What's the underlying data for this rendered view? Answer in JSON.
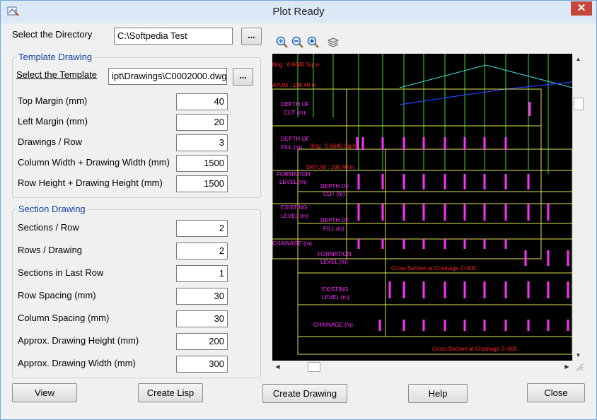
{
  "window": {
    "title": "Plot Ready",
    "close_glyph": "✕"
  },
  "directory": {
    "label": "Select the Directory",
    "value": "C:\\Softpedia Test",
    "browse_label": "..."
  },
  "template_group": {
    "title": "Template Drawing",
    "select_label": "Select the Template",
    "template_value": "ipt\\Drawings\\C0002000.dwg",
    "browse_label": "...",
    "fields": [
      {
        "label": "Top Margin (mm)",
        "value": "40"
      },
      {
        "label": "Left Margin (mm)",
        "value": "20"
      },
      {
        "label": "Drawings / Row",
        "value": "3"
      },
      {
        "label": "Column Width + Drawing Width (mm)",
        "value": "1500"
      },
      {
        "label": "Row Height + Drawing Height (mm)",
        "value": "1500"
      }
    ]
  },
  "section_group": {
    "title": "Section Drawing",
    "fields": [
      {
        "label": "Sections / Row",
        "value": "2"
      },
      {
        "label": "Rows / Drawing",
        "value": "2"
      },
      {
        "label": "Sections in Last Row",
        "value": "1"
      },
      {
        "label": "Row Spacing (mm)",
        "value": "30"
      },
      {
        "label": "Column Spacing (mm)",
        "value": "30"
      },
      {
        "label": "Approx. Drawing Height (mm)",
        "value": "200"
      },
      {
        "label": "Approx. Drawing Width (mm)",
        "value": "300"
      }
    ]
  },
  "toolbar": {
    "icons": [
      "zoom-extents-icon",
      "zoom-out-icon",
      "zoom-in-icon",
      "layers-icon"
    ]
  },
  "cad_preview": {
    "labels": {
      "area_top": "lling : 0.6640 Sq m",
      "datum_top": "ATUM : 108.40 m",
      "depth_cut": [
        "DEPTH OF",
        "CUT (m)"
      ],
      "depth_fill": [
        "DEPTH OF",
        "FILL (m)"
      ],
      "area_mid": "lling : 0.6640 Sq m",
      "datum_mid": "DATUM : 108.40 m",
      "formation": [
        "FORMATION",
        "LEVEL (m)"
      ],
      "existing": [
        "EXISTING",
        "LEVEL (m)"
      ],
      "chainage": "CHAINAGE (m)",
      "depth_cut_2": [
        "DEPTH OF",
        "CUT (m)"
      ],
      "depth_fill_2": [
        "DEPTH OF",
        "FILL (m)"
      ],
      "formation_2": [
        "FORMATION",
        "LEVEL (m)"
      ],
      "existing_2": [
        "EXISTING",
        "LEVEL (m)"
      ],
      "chainage_2": "CHAINAGE (m)",
      "cross_section_1": "Cross Section at Chainage 2+000",
      "cross_section_2": "Cross Section at Chainage 2+000"
    },
    "colors": {
      "background": "#000000",
      "frame": "#e0e050",
      "text": "#ff30ff",
      "profile": "#40e0e0",
      "ground": "#2040ff",
      "grid": "#30e030",
      "title": "#ff2020"
    }
  },
  "buttons": {
    "view": "View",
    "create_lisp": "Create Lisp",
    "create_drawing": "Create Drawing",
    "help": "Help",
    "close": "Close"
  }
}
